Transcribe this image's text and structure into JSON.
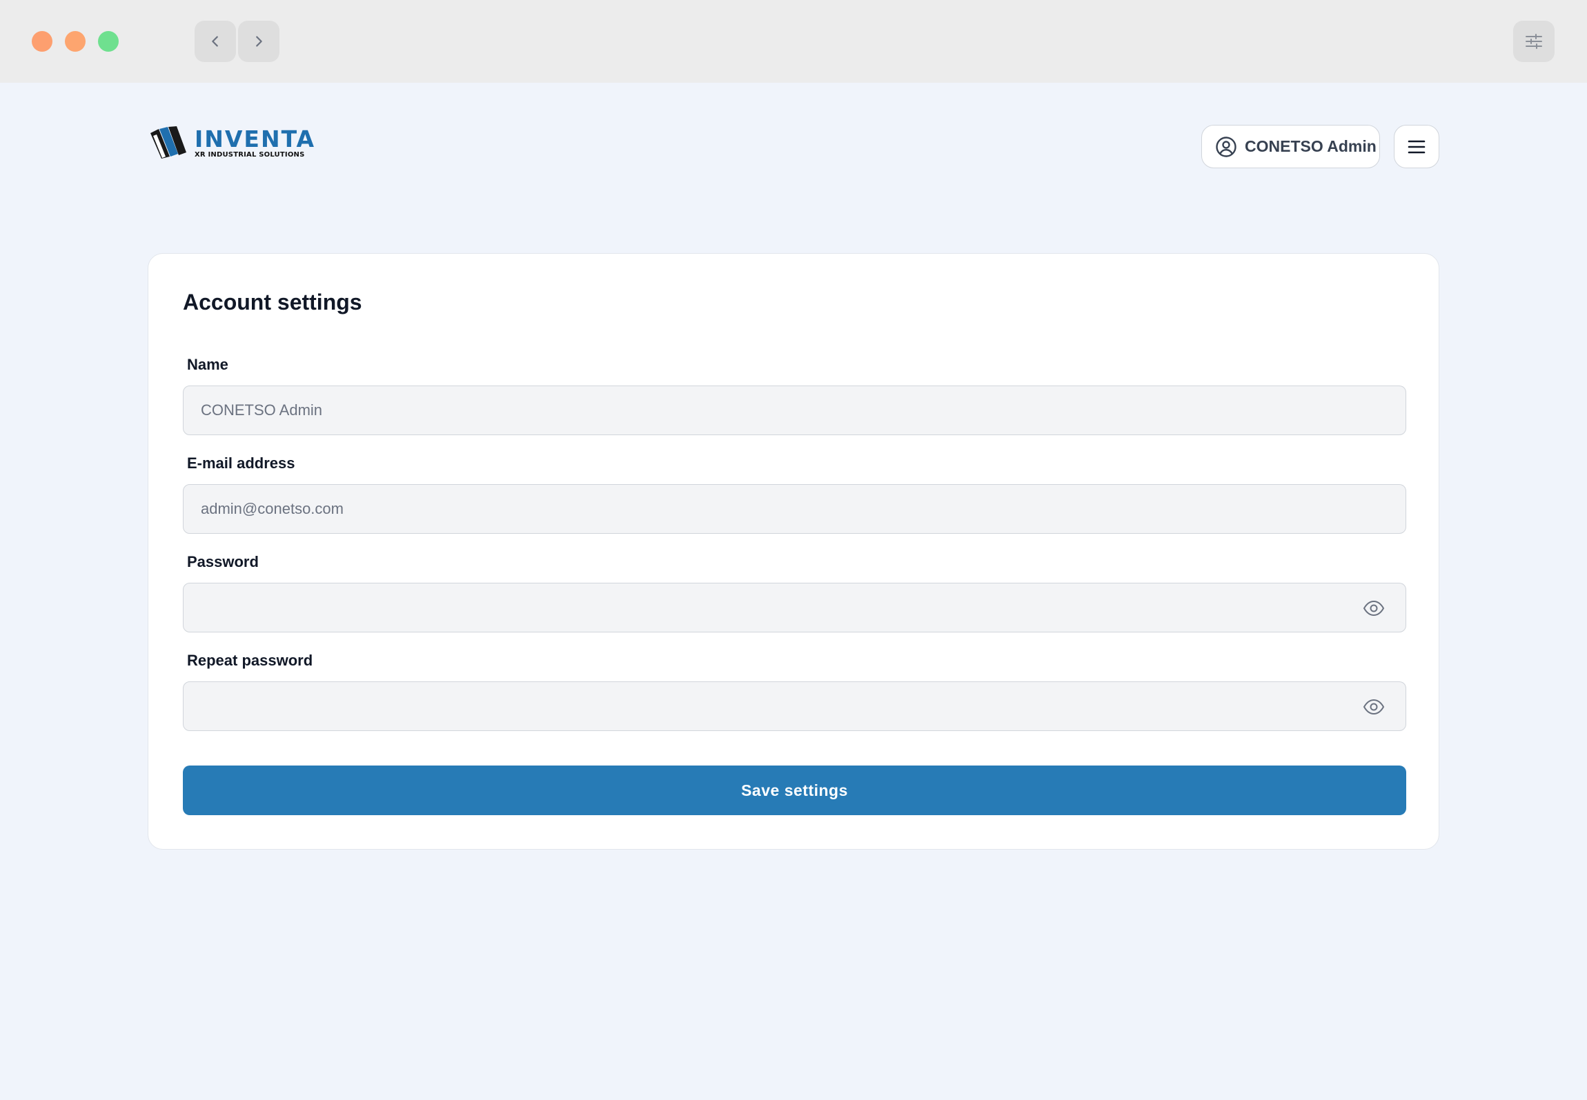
{
  "window": {
    "controls": [
      "close",
      "minimize",
      "maximize"
    ],
    "back_icon": "chevron-left-icon",
    "forward_icon": "chevron-right-icon",
    "settings_icon": "sliders-icon"
  },
  "header": {
    "logo": {
      "name": "INVENTA",
      "tagline": "XR INDUSTRIAL SOLUTIONS"
    },
    "user": {
      "name": "CONETSO Admin",
      "icon": "user-circle-icon"
    },
    "menu_icon": "hamburger-icon"
  },
  "form": {
    "title": "Account settings",
    "fields": [
      {
        "label": "Name",
        "value": "CONETSO Admin",
        "type": "text"
      },
      {
        "label": "E-mail address",
        "value": "admin@conetso.com",
        "type": "email"
      },
      {
        "label": "Password",
        "value": "",
        "type": "password",
        "icon": "eye-icon"
      },
      {
        "label": "Repeat password",
        "value": "",
        "type": "password",
        "icon": "eye-icon"
      }
    ],
    "submit_label": "Save settings"
  },
  "colors": {
    "brand_blue": "#1f6fae",
    "primary_button": "#277bb6",
    "page_background": "#f0f4fb"
  }
}
